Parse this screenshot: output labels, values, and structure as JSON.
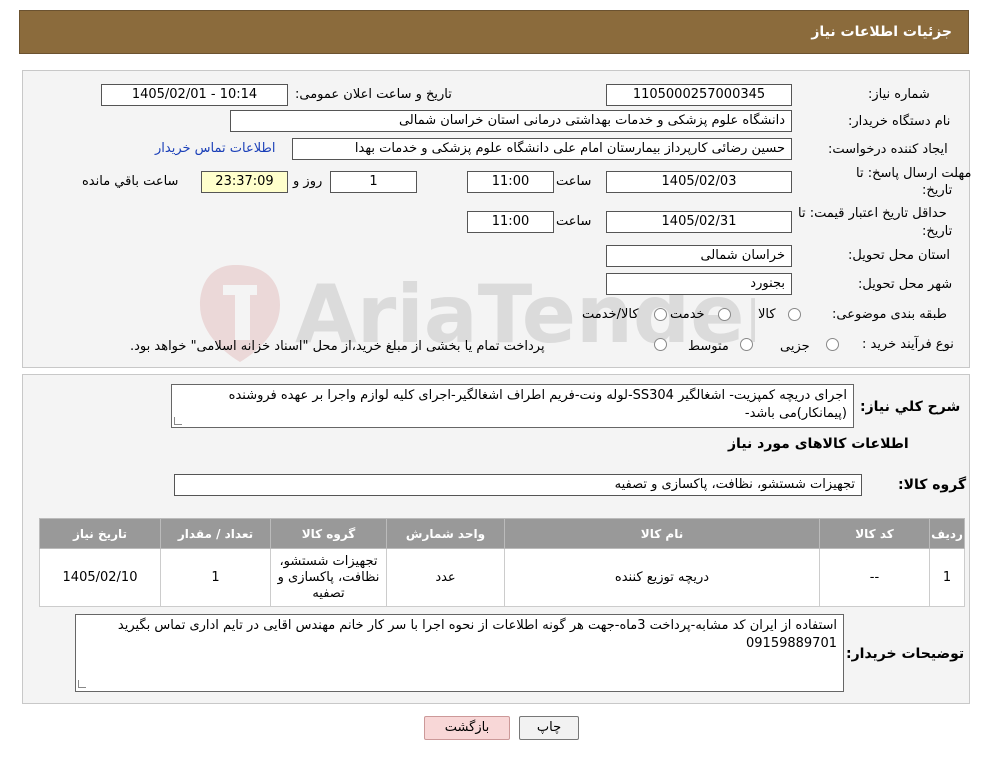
{
  "header": {
    "title": "جزئیات اطلاعات نیاز"
  },
  "form": {
    "need_number_label": "شماره نیاز:",
    "need_number": "1105000257000345",
    "announce_label": "تاریخ و ساعت اعلان عمومی:",
    "announce_value": "1405/02/01 - 10:14",
    "buyer_org_label": "نام دستگاه خریدار:",
    "buyer_org": "دانشگاه علوم پزشکی و خدمات بهداشتی درمانی استان خراسان شمالی",
    "creator_label": "ایجاد کننده درخواست:",
    "creator": "حسین رضائی کارپرداز بیمارستان امام علی دانشگاه علوم پزشکی و خدمات بهدا",
    "contact_link": "اطلاعات تماس خریدار",
    "deadline_label_1": "مهلت ارسال پاسخ: تا",
    "deadline_label_2": "تاریخ:",
    "deadline_date": "1405/02/03",
    "time_label": "ساعت",
    "deadline_time": "11:00",
    "days_value": "1",
    "days_label": "روز و",
    "remaining_time": "23:37:09",
    "remaining_label": "ساعت باقي مانده",
    "validity_label_1": "حداقل تاریخ اعتبار قیمت: تا",
    "validity_label_2": "تاریخ:",
    "validity_date": "1405/02/31",
    "validity_time": "11:00",
    "province_label": "استان محل تحویل:",
    "province": "خراسان شمالی",
    "city_label": "شهر محل تحویل:",
    "city": "بجنورد",
    "category_label": "طبقه بندی موضوعی:",
    "category_options": [
      "کالا",
      "خدمت",
      "کالا/خدمت"
    ],
    "process_label": "نوع فرآیند خرید :",
    "process_options": [
      "جزیی",
      "متوسط"
    ],
    "process_note": "پرداخت تمام یا بخشی از مبلغ خرید،از محل \"اسناد خزانه اسلامی\" خواهد بود."
  },
  "details": {
    "summary_label": "شرح کلي نیاز:",
    "summary": "اجرای دریچه کمپزیت- اشغالگیر SS304-لوله ونت-فریم اطراف اشغالگیر-اجرای کلیه لوازم واجرا بر عهده فروشنده (پیمانکار)می باشد-",
    "goods_info_title": "اطلاعات کالاهای مورد نیاز",
    "goods_group_label": "گروه کالا:",
    "goods_group": "تجهیزات شستشو، نظافت، پاکسازی و تصفیه",
    "table": {
      "headers": [
        "ردیف",
        "کد کالا",
        "نام کالا",
        "واحد شمارش",
        "گروه کالا",
        "تعداد / مقدار",
        "تاریخ نیاز"
      ],
      "rows": [
        [
          "1",
          "--",
          "دریچه توزیع کننده",
          "عدد",
          "تجهیزات شستشو، نظافت، پاکسازی و تصفیه",
          "1",
          "1405/02/10"
        ]
      ]
    },
    "buyer_notes_label": "توضیحات خریدار:",
    "buyer_notes": "استفاده از ایران کد مشابه-پرداخت 3ماه-جهت هر گونه اطلاعات از نحوه اجرا با سر کار خانم مهندس اقایی در تایم اداری تماس بگیرید 09159889701"
  },
  "buttons": {
    "print": "چاپ",
    "back": "بازگشت"
  },
  "watermark": {
    "text": "AriaTender.neT"
  },
  "colors": {
    "header_bg": "#8B6B3C",
    "link": "#1a3fb8",
    "table_header": "#999999",
    "back_button": "#f8d7d7"
  }
}
